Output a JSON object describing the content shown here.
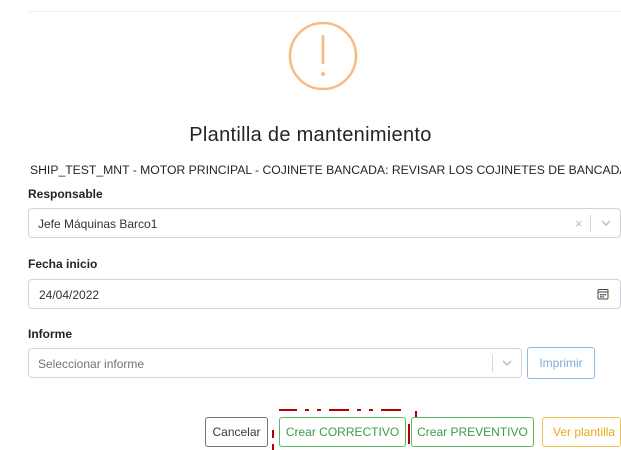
{
  "dialog": {
    "title": "Plantilla de mantenimiento",
    "subtitle": "SHIP_TEST_MNT - MOTOR PRINCIPAL - COJINETE BANCADA: REVISAR LOS COJINETES DE BANCADA"
  },
  "icons": {
    "warning": "warning-exclamation-icon",
    "clear": "clear-x-icon",
    "chevron": "chevron-down-icon",
    "calendar": "calendar-icon"
  },
  "form": {
    "responsable": {
      "label": "Responsable",
      "value": "Jefe Máquinas Barco1",
      "clear_glyph": "×"
    },
    "fecha_inicio": {
      "label": "Fecha inicio",
      "value": "24/04/2022"
    },
    "informe": {
      "label": "Informe",
      "placeholder": "Seleccionar informe",
      "print_label": "Imprimir"
    }
  },
  "footer": {
    "cancel_label": "Cancelar",
    "corrective_label": "Crear CORRECTIVO",
    "preventive_label": "Crear PREVENTIVO",
    "template_label": "Ver plantilla"
  },
  "colors": {
    "warning": "#f8bb86",
    "success": "#5cb85c",
    "warning_button": "#f0c24b",
    "primary_outline": "#8fb9e6",
    "annotation": "#b00000"
  }
}
